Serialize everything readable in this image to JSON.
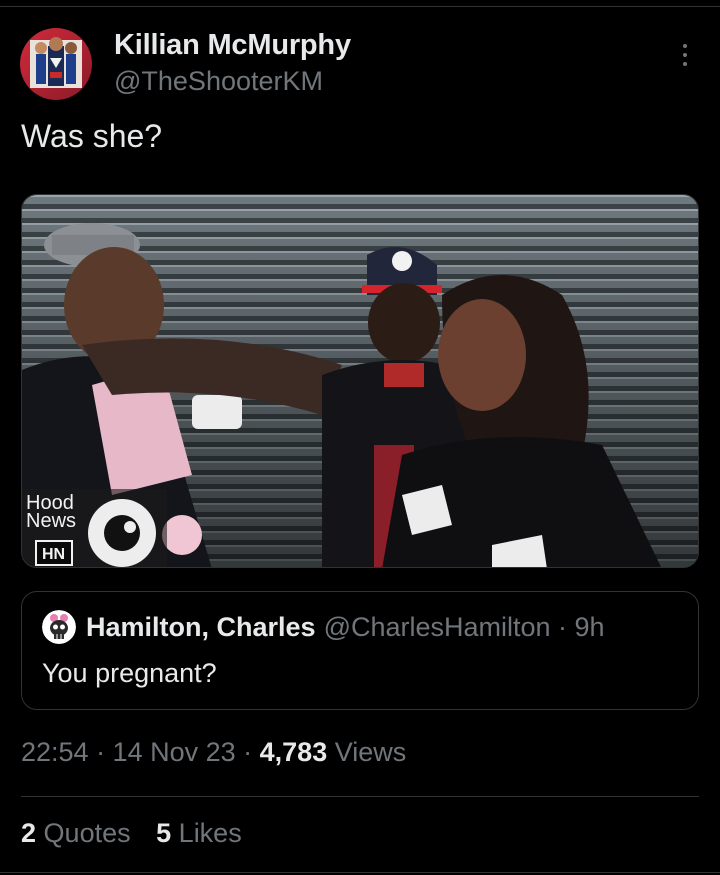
{
  "author": {
    "display_name": "Killian McMurphy",
    "handle": "@TheShooterKM"
  },
  "tweet": {
    "text": "Was she?"
  },
  "media": {
    "watermark_line1": "Hood",
    "watermark_line2": "News",
    "watermark_badge": "HN"
  },
  "quote": {
    "display_name": "Hamilton, Charles",
    "handle_time": "@CharlesHamilton · 9h",
    "text": "You pregnant?"
  },
  "meta": {
    "time_date": "22:54 · 14 Nov 23 · ",
    "views_count": "4,783",
    "views_label": "Views"
  },
  "stats": {
    "quotes_count": "2",
    "quotes_label": "Quotes",
    "likes_count": "5",
    "likes_label": "Likes"
  },
  "colors": {
    "background": "#000000",
    "primary_text": "#e7e9ea",
    "secondary_text": "#71767b",
    "divider": "#2f3336"
  }
}
